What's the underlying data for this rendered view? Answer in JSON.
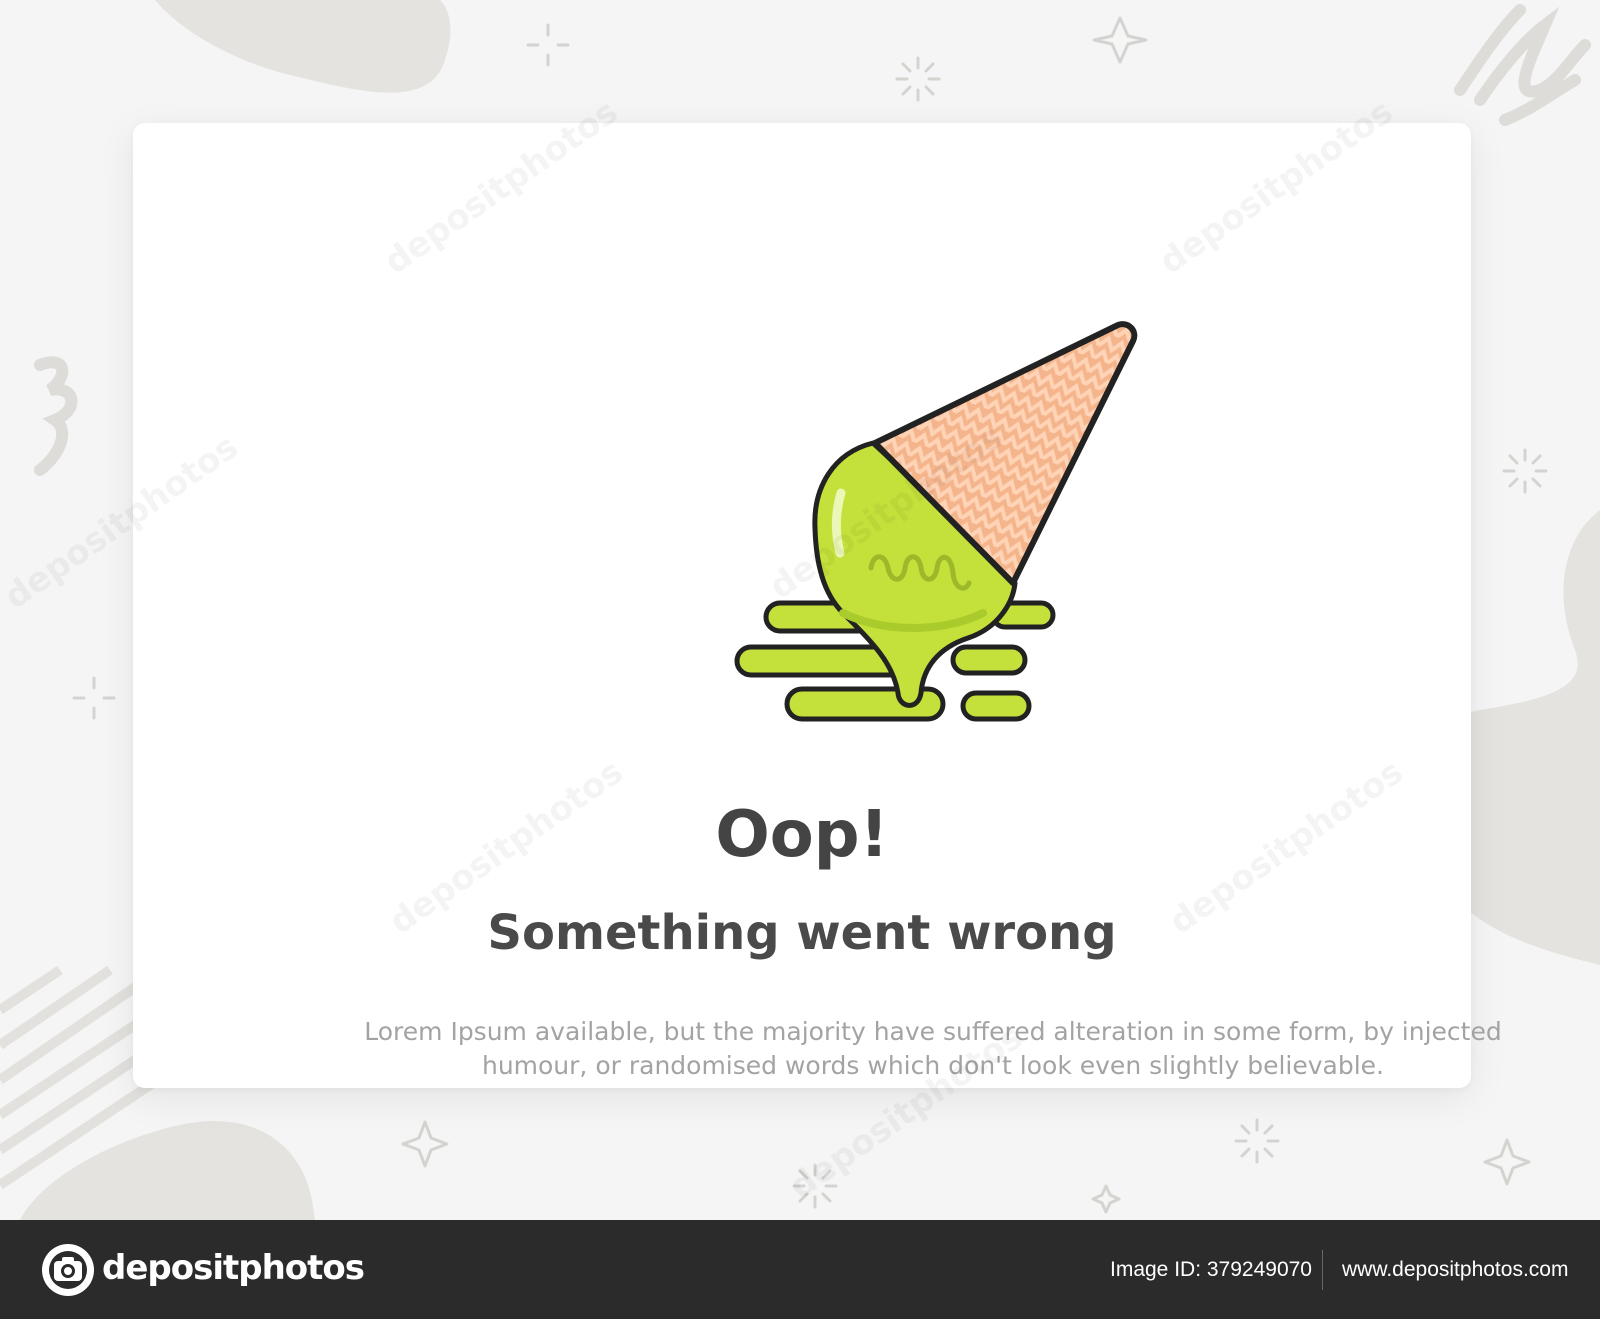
{
  "card": {
    "title": "Oop!",
    "subtitle": "Something went wrong",
    "description": "Lorem Ipsum available, but the majority have suffered alteration in some form, by injected humour, or randomised words which don't look even slightly believable."
  },
  "illustration": {
    "name": "melting-ice-cream",
    "icon": "ice-cream-cone-icon"
  },
  "watermark": {
    "text": "depositphotos"
  },
  "footer": {
    "brand": "depositphotos",
    "image_id": "Image ID: 379249070",
    "url": "www.depositphotos.com"
  },
  "colors": {
    "background": "#f5f5f5",
    "card": "#ffffff",
    "ice_cream": "#c4e03a",
    "cone": "#f5b58c",
    "footer": "#2b2b2b",
    "title_text": "#444444",
    "body_text": "#a3a3a3"
  }
}
